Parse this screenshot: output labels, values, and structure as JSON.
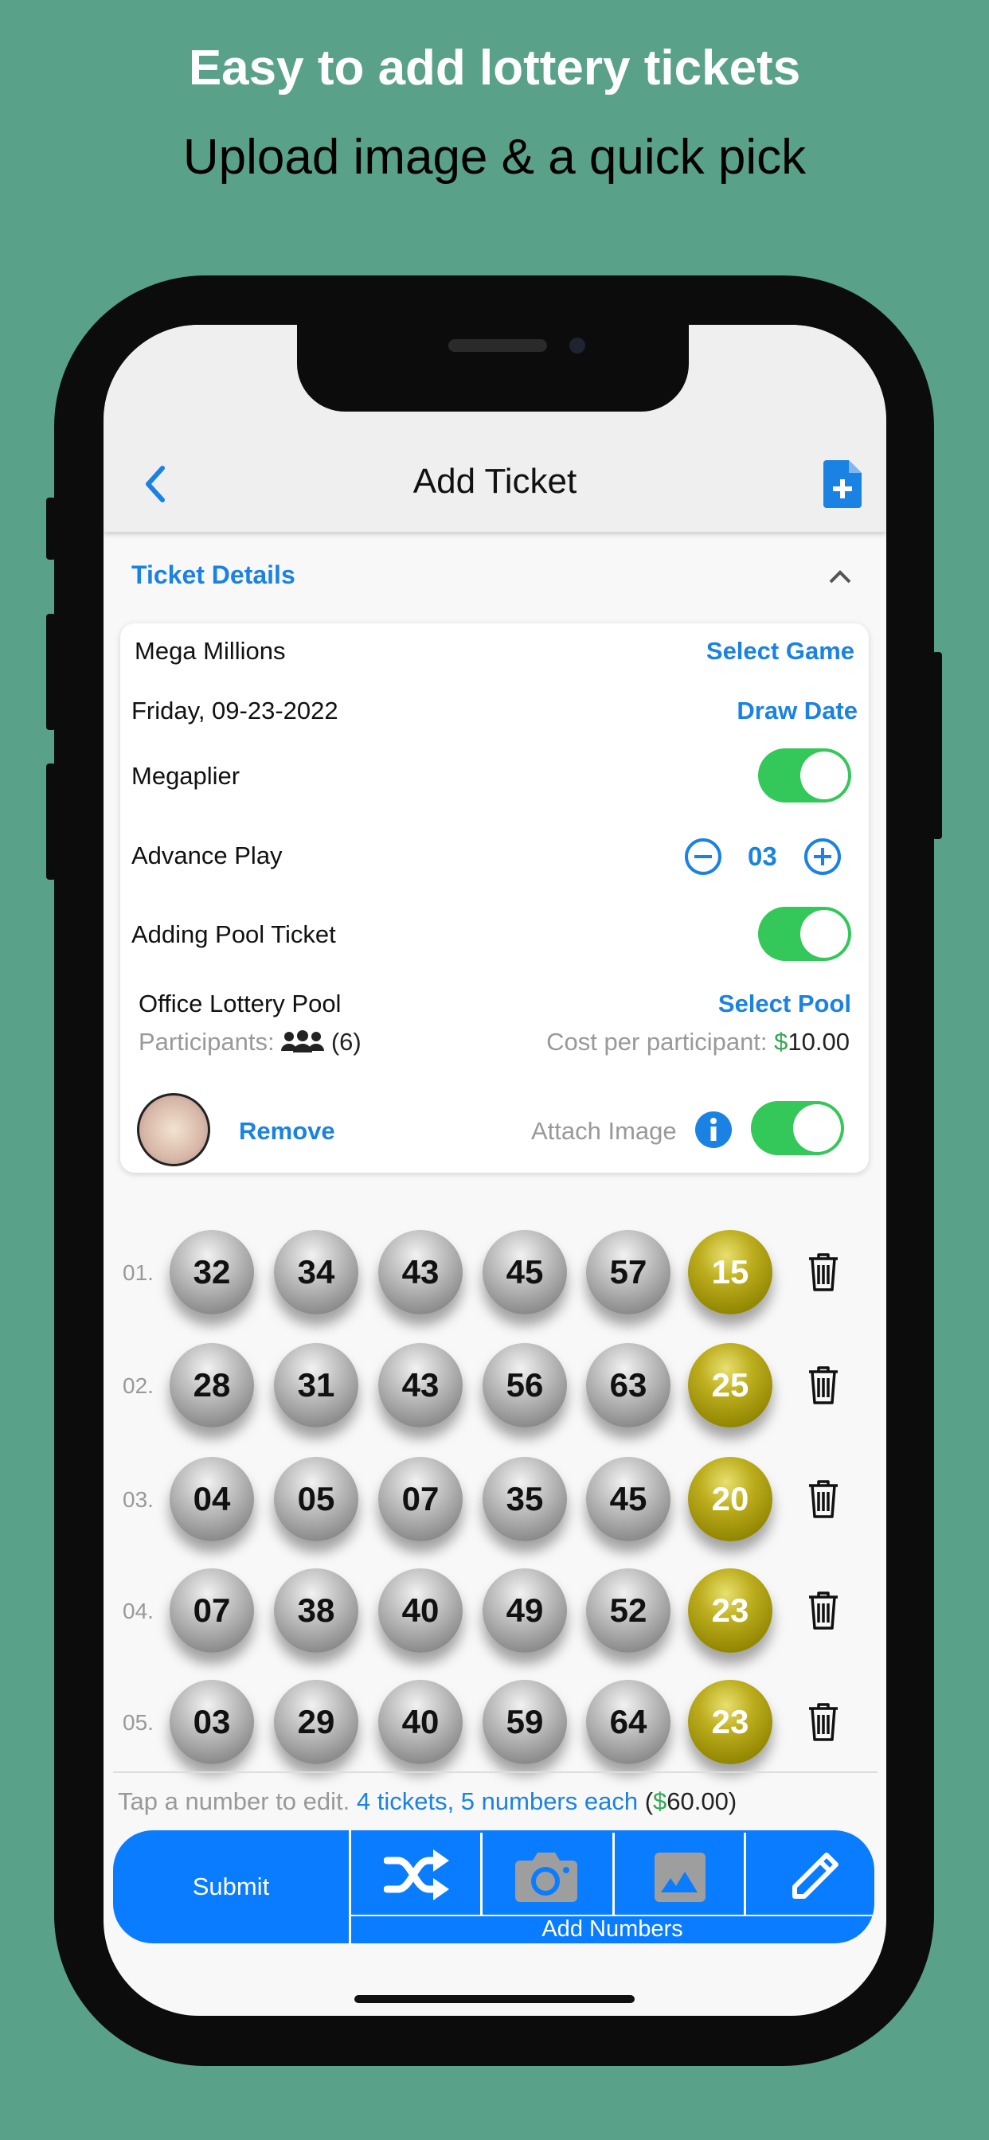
{
  "headline": "Easy to add lottery tickets",
  "subheadline": "Upload image & a quick pick",
  "nav": {
    "title": "Add Ticket",
    "back_icon": "chevron-left-icon",
    "action_icon": "document-add-icon"
  },
  "section": {
    "title": "Ticket Details",
    "collapse_icon": "chevron-up-icon"
  },
  "details": {
    "game": "Mega Millions",
    "select_game": "Select Game",
    "date": "Friday, 09-23-2022",
    "draw_date": "Draw Date",
    "megaplier_label": "Megaplier",
    "megaplier_on": true,
    "advance_label": "Advance Play",
    "advance_value": "03",
    "pool_toggle_label": "Adding Pool Ticket",
    "pool_on": true,
    "pool_name": "Office Lottery Pool",
    "select_pool": "Select Pool",
    "participants_label": "Participants:",
    "participants_count": "(6)",
    "cost_label": "Cost per participant:",
    "cost_currency": "$",
    "cost_value": "10.00",
    "remove": "Remove",
    "attach_label": "Attach Image",
    "attach_on": true
  },
  "tickets": [
    {
      "label": "01.",
      "numbers": [
        "32",
        "34",
        "43",
        "45",
        "57"
      ],
      "mega": "15"
    },
    {
      "label": "02.",
      "numbers": [
        "28",
        "31",
        "43",
        "56",
        "63"
      ],
      "mega": "25"
    },
    {
      "label": "03.",
      "numbers": [
        "04",
        "05",
        "07",
        "35",
        "45"
      ],
      "mega": "20"
    },
    {
      "label": "04.",
      "numbers": [
        "07",
        "38",
        "40",
        "49",
        "52"
      ],
      "mega": "23"
    },
    {
      "label": "05.",
      "numbers": [
        "03",
        "29",
        "40",
        "59",
        "64"
      ],
      "mega": "23"
    }
  ],
  "footer": {
    "hint": "Tap a number to edit.",
    "summary": "4 tickets, 5 numbers each",
    "open": "(",
    "currency": "$",
    "total": "60.00",
    "close": ")"
  },
  "actions": {
    "submit": "Submit",
    "add_numbers": "Add Numbers"
  },
  "colors": {
    "accent": "#1a82e2",
    "toggle": "#34c759",
    "button": "#0a7cff",
    "background": "#5aa18a",
    "money": "#34a853"
  }
}
